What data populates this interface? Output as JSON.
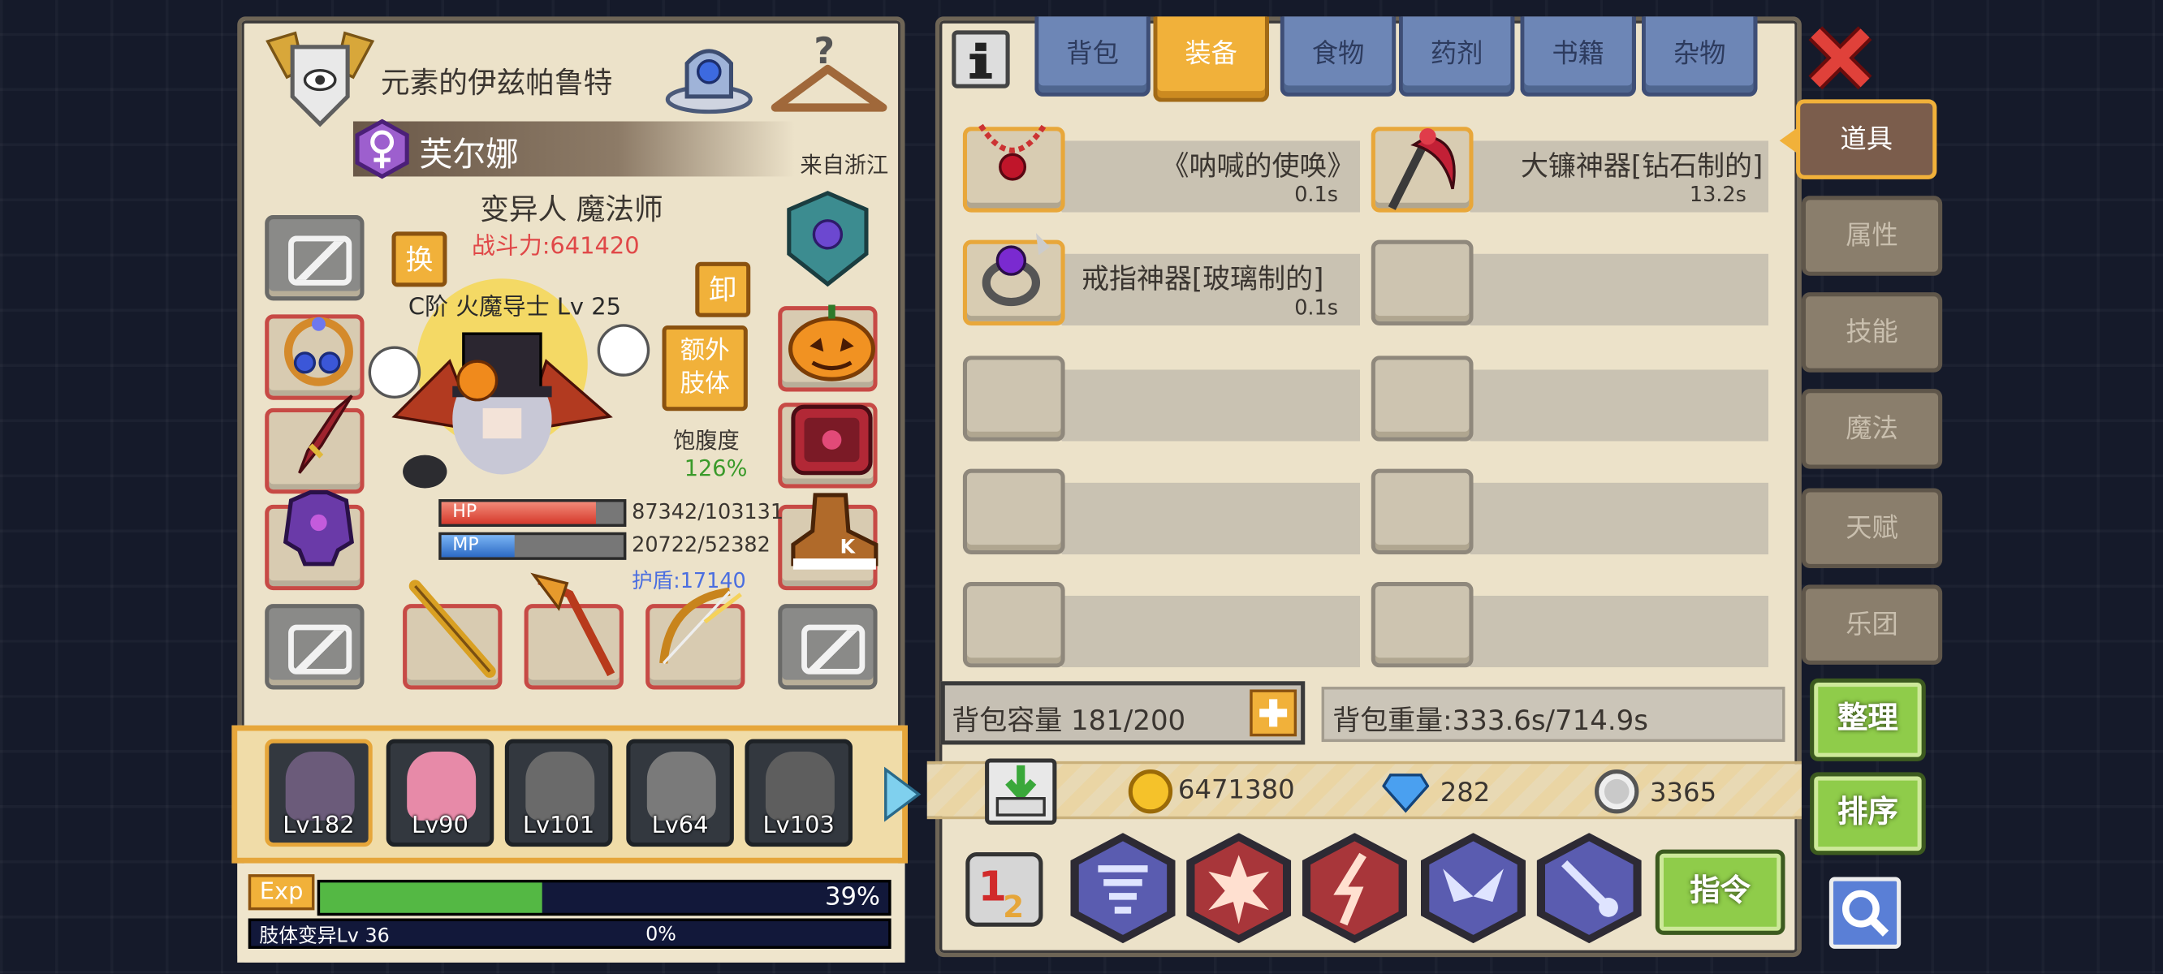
{
  "character": {
    "title": "元素的伊兹帕鲁特",
    "name": "芙尔娜",
    "origin": "来自浙江",
    "class": "变异人 魔法师",
    "power": "战斗力:641420",
    "rank": "C阶 火魔导士 Lv 25",
    "swap_label": "换",
    "unequip_label": "卸",
    "extra_limb_label": "额外\n肢体",
    "satiety_label": "饱腹度",
    "satiety_value": "126%",
    "hp_label": "HP",
    "hp_value": "87342/103131",
    "hp_fraction": 0.85,
    "mp_label": "MP",
    "mp_value": "20722/52382",
    "mp_fraction": 0.4,
    "shield": "护盾:17140"
  },
  "party": [
    {
      "level": "Lv182",
      "color": "#6b5b7a"
    },
    {
      "level": "Lv90",
      "color": "#e78aa8"
    },
    {
      "level": "Lv101",
      "color": "#6a6a6a"
    },
    {
      "level": "Lv64",
      "color": "#7a7a7a"
    },
    {
      "level": "Lv103",
      "color": "#5e5e5e"
    }
  ],
  "exp": {
    "label": "Exp",
    "percent_text": "39%",
    "fraction": 0.39,
    "sub_label": "肢体变异Lv 36",
    "sub_percent": "0%"
  },
  "tabs": [
    "背包",
    "装备",
    "食物",
    "药剂",
    "书籍",
    "杂物"
  ],
  "active_tab": 1,
  "side_tabs": [
    "道具",
    "属性",
    "技能",
    "魔法",
    "天赋",
    "乐团"
  ],
  "items": [
    {
      "name": "《呐喊的使唤》",
      "weight": "0.1s"
    },
    {
      "name": "大镰神器[钻石制的]",
      "weight": "13.2s"
    },
    {
      "name": "戒指神器[玻璃制的]",
      "weight": "0.1s"
    },
    {
      "name": "",
      "weight": ""
    },
    {
      "name": "",
      "weight": ""
    },
    {
      "name": "",
      "weight": ""
    },
    {
      "name": "",
      "weight": ""
    },
    {
      "name": "",
      "weight": ""
    },
    {
      "name": "",
      "weight": ""
    },
    {
      "name": "",
      "weight": ""
    }
  ],
  "bag": {
    "capacity": "背包容量 181/200",
    "weight": "背包重量:333.6s/714.9s"
  },
  "currency": {
    "gold": "6471380",
    "diamond": "282",
    "silver": "3365"
  },
  "buttons": {
    "sort": "整理",
    "order": "排序",
    "command": "指令"
  },
  "icons": {
    "info": "info-icon",
    "close": "close-icon",
    "search": "search-icon",
    "plus": "plus-icon"
  }
}
